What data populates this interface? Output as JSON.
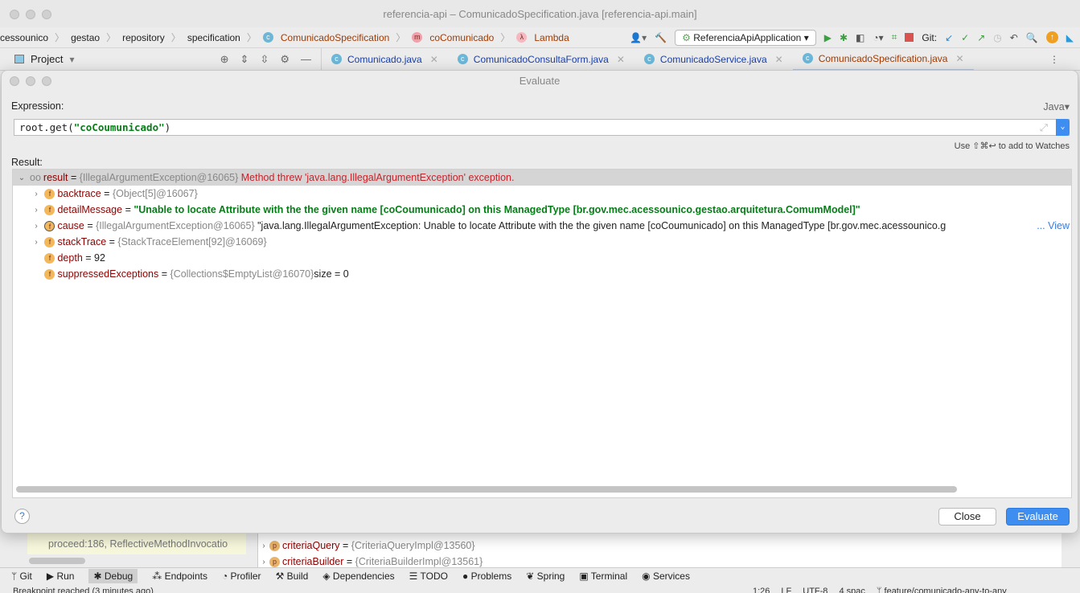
{
  "window": {
    "title": "referencia-api – ComunicadoSpecification.java [referencia-api.main]"
  },
  "breadcrumb": [
    "cessounico",
    "gestao",
    "repository",
    "specification",
    "ComunicadoSpecification",
    "coComunicado",
    "Lambda"
  ],
  "toolbar": {
    "run_config": "ReferenciaApiApplication",
    "git_label": "Git:"
  },
  "project_panel": {
    "label": "Project"
  },
  "tabs": [
    {
      "label": "Comunicado.java"
    },
    {
      "label": "ComunicadoConsultaForm.java"
    },
    {
      "label": "ComunicadoService.java"
    },
    {
      "label": "ComunicadoSpecification.java",
      "active": true
    }
  ],
  "dialog": {
    "title": "Evaluate",
    "expression_label": "Expression:",
    "language": "Java",
    "expression": {
      "prefix": "root.get(",
      "string": "\"coCoumunicado\"",
      "suffix": ")"
    },
    "hint": "Use ⇧⌘↩ to add to Watches",
    "result_label": "Result:",
    "result": {
      "name": "result",
      "value": "{IllegalArgumentException@16065}",
      "message": "Method threw 'java.lang.IllegalArgumentException' exception."
    },
    "children": [
      {
        "name": "backtrace",
        "value": "{Object[5]@16067}",
        "expandable": true
      },
      {
        "name": "detailMessage",
        "value": "\"Unable to locate Attribute  with the the given name [coCoumunicado] on this ManagedType [br.gov.mec.acessounico.gestao.arquitetura.ComumModel]\"",
        "expandable": true,
        "kind": "string"
      },
      {
        "name": "cause",
        "value": "{IllegalArgumentException@16065}",
        "extra": "\"java.lang.IllegalArgumentException: Unable to locate Attribute  with the the given name [coCoumunicado] on this ManagedType [br.gov.mec.acessounico.g",
        "link": "... View",
        "expandable": true
      },
      {
        "name": "stackTrace",
        "value": "{StackTraceElement[92]@16069}",
        "expandable": true
      },
      {
        "name": "depth",
        "value": "92"
      },
      {
        "name": "suppressedExceptions",
        "value": "{Collections$EmptyList@16070}",
        "extra": " size = 0"
      }
    ],
    "close_label": "Close",
    "evaluate_label": "Evaluate",
    "help": "?"
  },
  "debug_behind": {
    "frame": "proceed:186, ReflectiveMethodInvocatio",
    "vars": [
      {
        "name": "criteriaQuery",
        "value": "{CriteriaQueryImpl@13560}"
      },
      {
        "name": "criteriaBuilder",
        "value": "{CriteriaBuilderImpl@13561}"
      }
    ]
  },
  "tool_windows": [
    "Git",
    "Run",
    "Debug",
    "Endpoints",
    "Profiler",
    "Build",
    "Dependencies",
    "TODO",
    "Problems",
    "Spring",
    "Terminal",
    "Services"
  ],
  "status": {
    "message": "Breakpoint reached (3 minutes ago)",
    "position": "1:26",
    "line_sep": "LF",
    "encoding": "UTF-8",
    "indent": "4 spac",
    "branch": "feature/comunicado-any-to-any"
  }
}
